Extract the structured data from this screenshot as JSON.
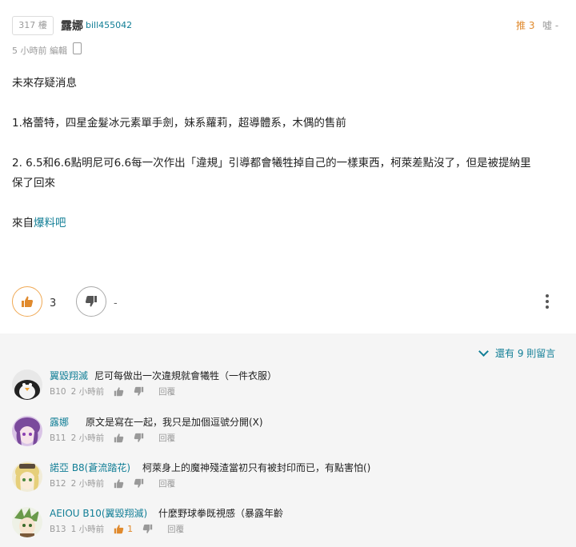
{
  "post": {
    "floor": "317 樓",
    "author": "露娜",
    "user_id": "bill455042",
    "push_label": "推 3",
    "hiss_label": "噓 -",
    "time": "5 小時前 編輯",
    "lines": [
      "未來存疑消息",
      "1.格蕾特，四星金髮冰元素單手劍，妹系蘿莉，超導體系，木偶的售前",
      "2.  6.5和6.6點明尼可6.6每一次作出「違規」引導都會犧牲掉自己的一樣東西，柯萊差點沒了，但是被提納里",
      "保了回來"
    ],
    "source_prefix": "來自",
    "source_link": "爆料吧",
    "like_count": "3",
    "dislike_count": "-"
  },
  "comments_section": {
    "more_label": "還有 9 則留言",
    "items": [
      {
        "name": "翼毀翔滅",
        "text": "尼可每做出一次違規就會犧牲（一件衣服）",
        "floor": "B10",
        "time": "2 小時前",
        "like_count": "",
        "reply": "回覆"
      },
      {
        "name": "露娜",
        "text": "原文是寫在一起，我只是加個逗號分開(X)",
        "floor": "B11",
        "time": "2 小時前",
        "like_count": "",
        "reply": "回覆"
      },
      {
        "name": "諾亞 B8(蒼流踏花)",
        "text": "柯萊身上的魔神殘渣當初只有被封印而已，有點害怕()",
        "floor": "B12",
        "time": "2 小時前",
        "like_count": "",
        "reply": "回覆"
      },
      {
        "name": "AEIOU B10(翼毀翔滅)",
        "text": "什麼野球拳既視感（暴露年齡",
        "floor": "B13",
        "time": "1 小時前",
        "like_count": "1",
        "reply": "回覆"
      }
    ]
  },
  "colors": {
    "accent": "#117e96",
    "push": "#e08a2d",
    "like_border": "#f0a955"
  },
  "icons": [
    "phone-icon",
    "like-icon",
    "dislike-icon",
    "more-icon",
    "chevron-down-icon"
  ]
}
